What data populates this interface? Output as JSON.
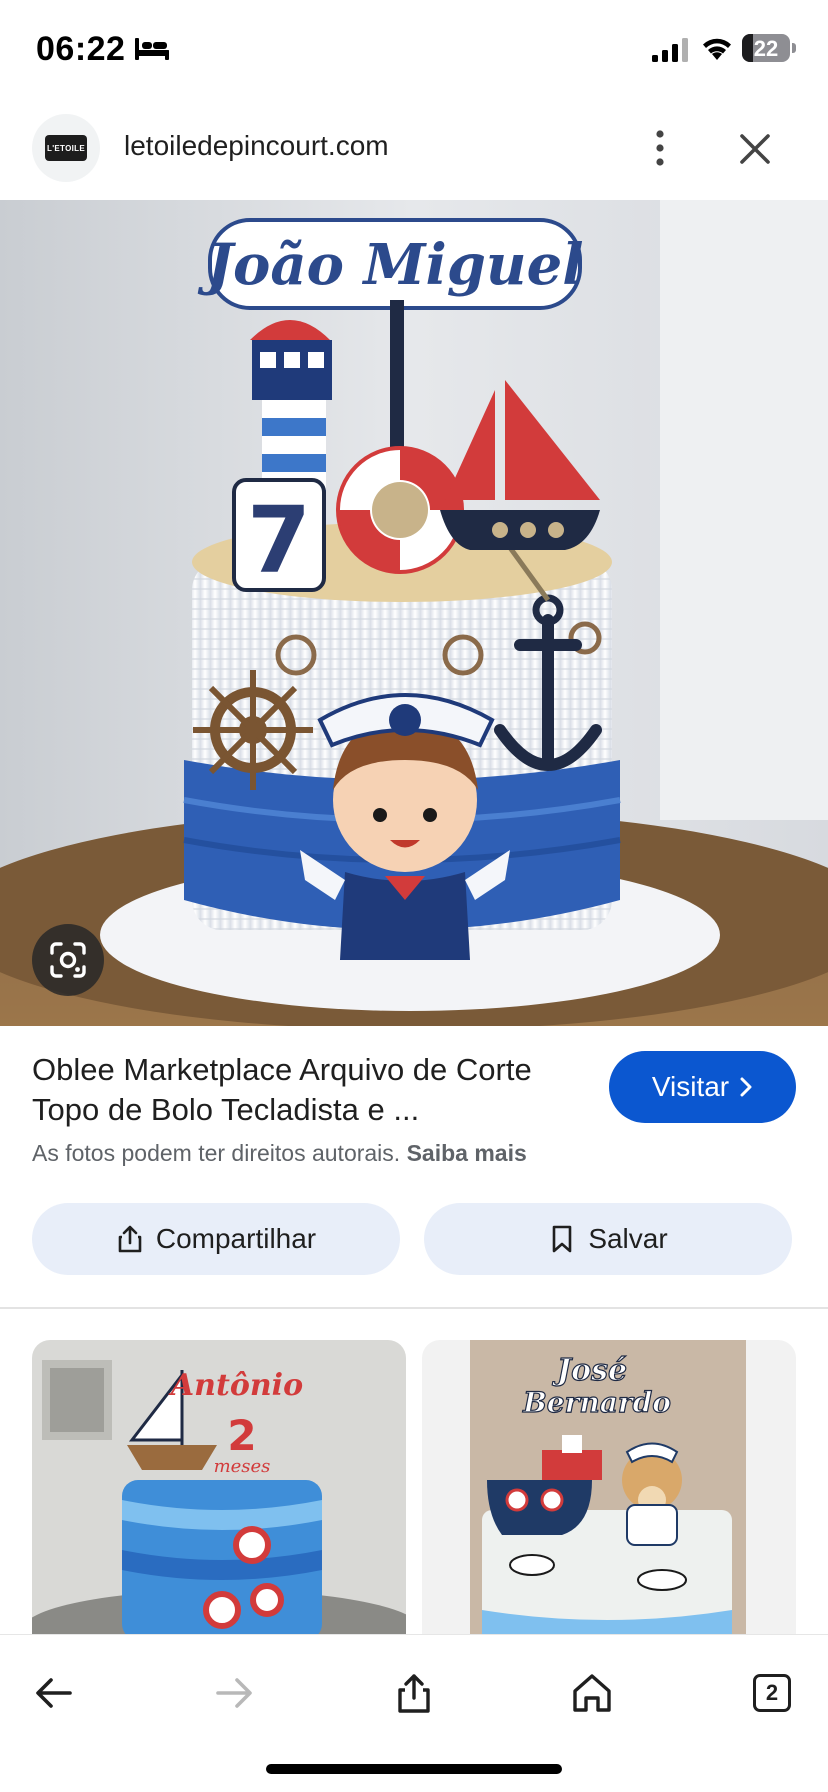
{
  "status_bar": {
    "time": "06:22",
    "battery": "22",
    "battery_level": 0.22,
    "icons": [
      "bed-icon",
      "signal-icon",
      "wifi-icon",
      "battery-icon"
    ]
  },
  "header": {
    "site_logo_text": "L'ETOILE",
    "url": "letoiledepincourt.com",
    "icons": [
      "more-vert-icon",
      "close-icon"
    ]
  },
  "hero": {
    "image_description_icon": "lens-icon",
    "cake_topper_name": "João Miguel",
    "cake_topper_number": "7"
  },
  "result": {
    "title": "Oblee Marketplace Arquivo de Corte Topo de Bolo Tecladista e ...",
    "visit_label": "Visitar",
    "copyright_text": "As fotos podem ter direitos autorais.",
    "learn_more": "Saiba mais",
    "share_label": "Compartilhar",
    "save_label": "Salvar"
  },
  "related": {
    "thumb1_topper": "Antônio",
    "thumb1_age": "2",
    "thumb1_age_unit": "meses",
    "thumb2_topper_line1": "José",
    "thumb2_topper_line2": "Bernardo"
  },
  "bottom_bar": {
    "tab_count": "2",
    "icons": [
      "back-arrow-icon",
      "forward-arrow-icon",
      "share-icon",
      "home-icon",
      "tabs-icon"
    ]
  },
  "colors": {
    "accent": "#0b57d0",
    "chip_bg": "#e8eef9",
    "secondary_text": "#5f6368"
  }
}
